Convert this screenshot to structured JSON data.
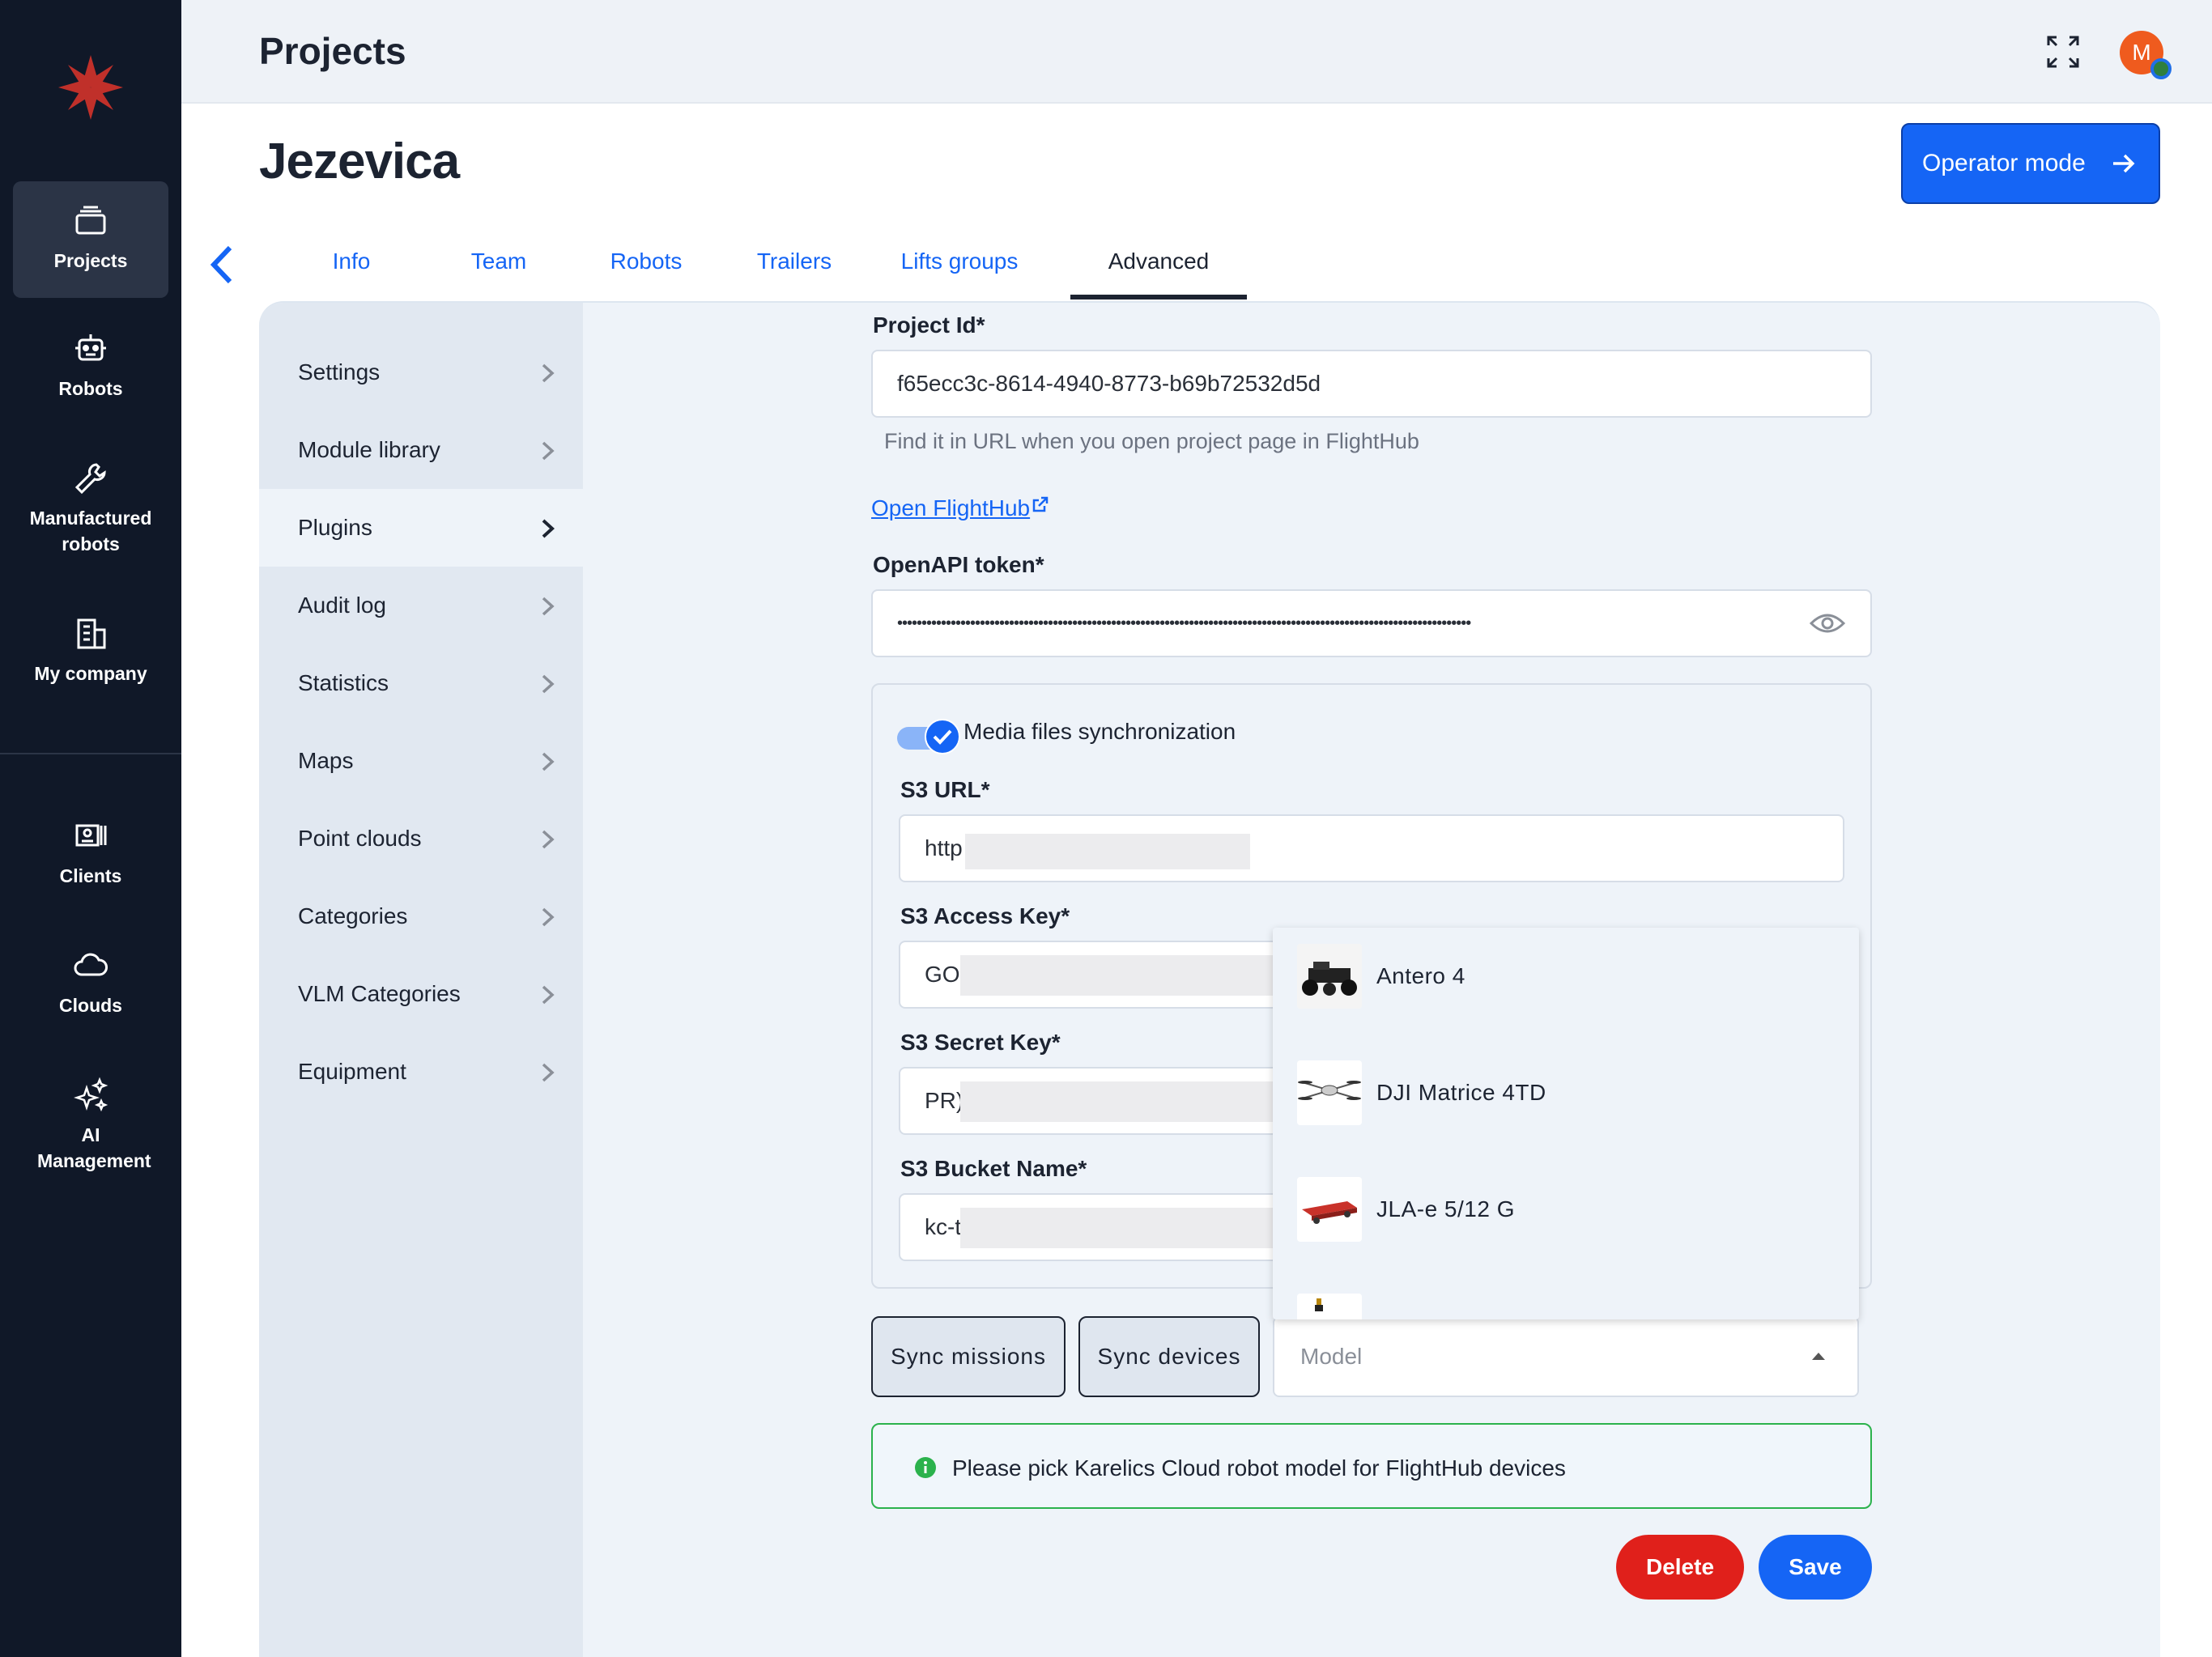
{
  "header": {
    "title": "Projects",
    "fullscreen_icon": "expand-icon",
    "avatar_initial": "M"
  },
  "nav": {
    "items": [
      {
        "label": "Projects",
        "icon": "folder-stack-icon",
        "active": true
      },
      {
        "label": "Robots",
        "icon": "robot-icon"
      },
      {
        "label": "Manufactured robots",
        "icon": "wrench-icon"
      },
      {
        "label": "My company",
        "icon": "building-icon"
      },
      {
        "label": "Clients",
        "icon": "client-card-icon"
      },
      {
        "label": "Clouds",
        "icon": "cloud-icon"
      },
      {
        "label": "AI Management",
        "icon": "sparkles-icon"
      }
    ]
  },
  "project": {
    "name": "Jezevica",
    "operator_button": "Operator mode"
  },
  "tabs": [
    {
      "label": "Info"
    },
    {
      "label": "Team"
    },
    {
      "label": "Robots"
    },
    {
      "label": "Trailers"
    },
    {
      "label": "Lifts groups"
    },
    {
      "label": "Advanced",
      "active": true
    }
  ],
  "subnav": [
    {
      "label": "Settings"
    },
    {
      "label": "Module library"
    },
    {
      "label": "Plugins",
      "active": true
    },
    {
      "label": "Audit log"
    },
    {
      "label": "Statistics"
    },
    {
      "label": "Maps"
    },
    {
      "label": "Point clouds"
    },
    {
      "label": "Categories"
    },
    {
      "label": "VLM Categories"
    },
    {
      "label": "Equipment"
    }
  ],
  "form": {
    "project_id_label": "Project Id*",
    "project_id_value": "f65ecc3c-8614-4940-8773-b69b72532d5d",
    "project_id_hint": "Find it in URL when you open project page in FlightHub",
    "open_link": "Open FlightHub",
    "token_label": "OpenAPI token*",
    "token_value": "••••••••••••••••••••••••••••••••••••••••••••••••••••••••••••••••••••••••••••••••••••••••••••••••••••••••••••••••••••••",
    "media_sync_label": "Media files synchronization",
    "s3_url_label": "S3 URL*",
    "s3_url_value": "http",
    "s3_access_label": "S3 Access Key*",
    "s3_access_value": "GO(",
    "s3_secret_label": "S3 Secret Key*",
    "s3_secret_value": "PR)",
    "s3_bucket_label": "S3 Bucket Name*",
    "s3_bucket_value": "kc-t"
  },
  "buttons": {
    "sync_missions": "Sync missions",
    "sync_devices": "Sync devices",
    "delete": "Delete",
    "save": "Save"
  },
  "model_select": {
    "placeholder": "Model",
    "options": [
      {
        "label": "Antero 4"
      },
      {
        "label": "DJI Matrice 4TD"
      },
      {
        "label": "JLA-e 5/12 G"
      }
    ]
  },
  "alert": {
    "text": "Please pick Karelics Cloud robot model for FlightHub devices"
  },
  "colors": {
    "accent": "#1565f5",
    "nav_bg": "#101828",
    "danger": "#e0201b",
    "success": "#2bb24c"
  }
}
